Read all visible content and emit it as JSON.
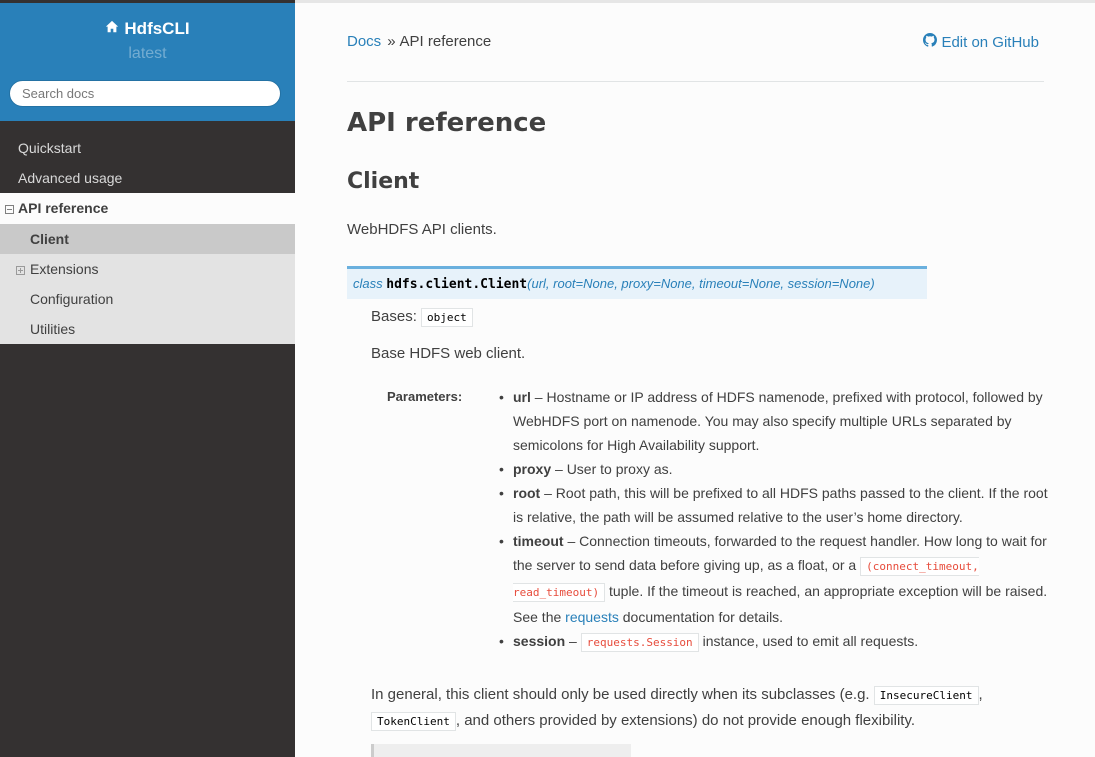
{
  "sidebar": {
    "brand": "HdfsCLI",
    "version": "latest",
    "search_placeholder": "Search docs",
    "nav": {
      "quickstart": "Quickstart",
      "advanced": "Advanced usage",
      "api": "API reference",
      "client": "Client",
      "extensions": "Extensions",
      "configuration": "Configuration",
      "utilities": "Utilities"
    },
    "colors": {
      "header": "#2980b9",
      "background": "#343131",
      "subnav": "#e3e3e3"
    }
  },
  "breadcrumbs": {
    "docs": "Docs",
    "separator": "»",
    "current": "API reference",
    "edit": "Edit on GitHub"
  },
  "page": {
    "title": "API reference",
    "section": "Client",
    "intro": "WebHDFS API clients.",
    "signature": {
      "keyword": "class",
      "name": "hdfs.client.Client",
      "params": "(url, root=None, proxy=None, timeout=None, session=None)"
    },
    "bases_label": "Bases:",
    "bases_value": "object",
    "description": "Base HDFS web client.",
    "parameters_label": "Parameters:",
    "parameters": {
      "url_name": "url",
      "url_text": " – Hostname or IP address of HDFS namenode, prefixed with protocol, followed by WebHDFS port on namenode. You may also specify multiple URLs separated by semicolons for High Availability support.",
      "proxy_name": "proxy",
      "proxy_text": " – User to proxy as.",
      "root_name": "root",
      "root_text": " – Root path, this will be prefixed to all HDFS paths passed to the client. If the root is relative, the path will be assumed relative to the user’s home directory.",
      "timeout_name": "timeout",
      "timeout_text_1": " – Connection timeouts, forwarded to the request handler. How long to wait for the server to send data before giving up, as a float, or a ",
      "timeout_code": "(connect_timeout, read_timeout)",
      "timeout_text_2": " tuple. If the timeout is reached, an appropriate exception will be raised. See the ",
      "timeout_link": "requests",
      "timeout_text_3": " documentation for details.",
      "session_name": "session",
      "session_text_1": " – ",
      "session_code": "requests.Session",
      "session_text_2": " instance, used to emit all requests."
    },
    "general": {
      "text_1": "In general, this client should only be used directly when its subclasses (e.g. ",
      "code_1": "InsecureClient",
      "text_2": ", ",
      "code_2": "TokenClient",
      "text_3": ", and others provided by extensions) do not provide enough flexibility."
    }
  }
}
